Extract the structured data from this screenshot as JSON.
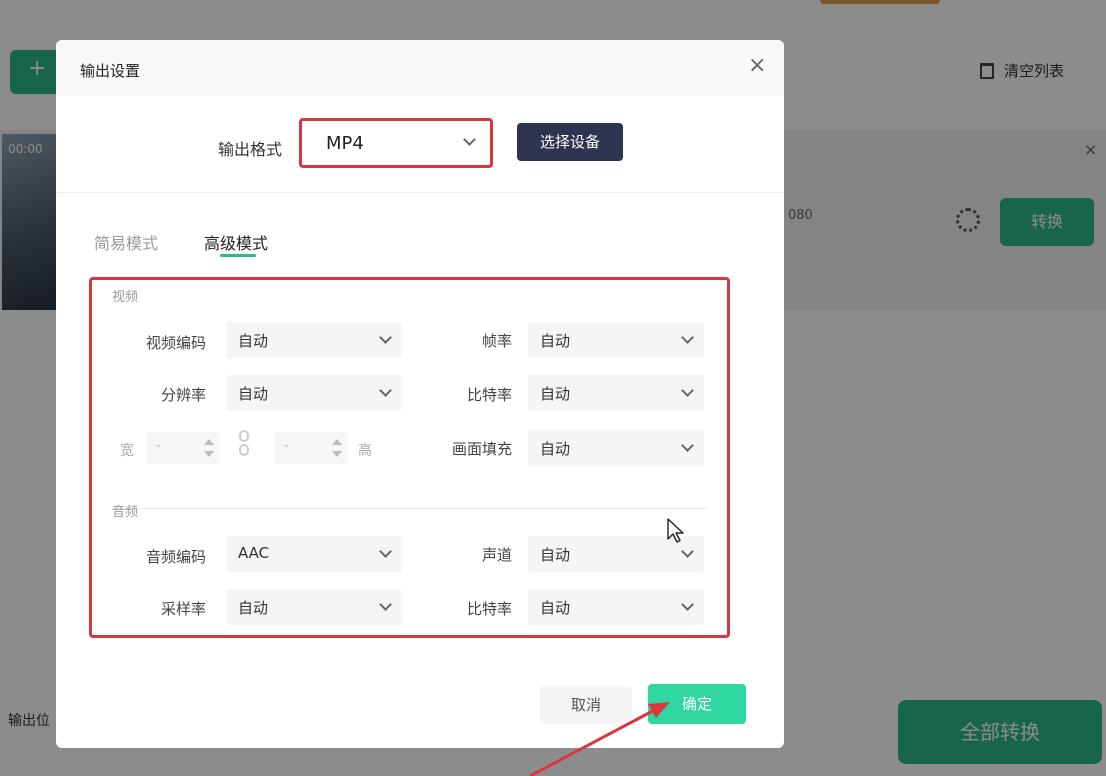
{
  "background": {
    "add_button_glyph": "+",
    "clear_list_label": "清空列表",
    "item_time": "00:00",
    "item_resolution": "080",
    "row_close_glyph": "×",
    "convert_label": "转换",
    "output_label": "输出位",
    "convert_all_label": "全部转换"
  },
  "dialog": {
    "title": "输出设置",
    "close_glyph": "×",
    "format_label": "输出格式",
    "format_value": "MP4",
    "select_device_label": "选择设备",
    "tabs": [
      {
        "label": "简易模式"
      },
      {
        "label": "高级模式"
      }
    ],
    "video_section_label": "视频",
    "audio_section_label": "音频",
    "video_codec": {
      "label": "视频编码",
      "value": "自动"
    },
    "frame_rate": {
      "label": "帧率",
      "value": "自动"
    },
    "resolution": {
      "label": "分辨率",
      "value": "自动"
    },
    "video_bitrate": {
      "label": "比特率",
      "value": "自动"
    },
    "width_label": "宽",
    "width_value": "-",
    "height_label": "高",
    "height_value": "-",
    "fill": {
      "label": "画面填充",
      "value": "自动"
    },
    "audio_codec": {
      "label": "音频编码",
      "value": "AAC"
    },
    "channel": {
      "label": "声道",
      "value": "自动"
    },
    "sample_rate": {
      "label": "采样率",
      "value": "自动"
    },
    "audio_bitrate": {
      "label": "比特率",
      "value": "自动"
    },
    "cancel_label": "取消",
    "confirm_label": "确定"
  },
  "colors": {
    "accent": "#2fb98a",
    "highlight_red": "#d9373d",
    "device_button": "#2e3350"
  }
}
